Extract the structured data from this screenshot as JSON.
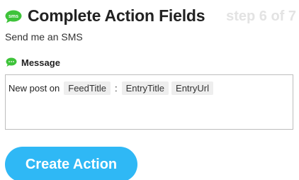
{
  "header": {
    "icon_text": "sms",
    "title": "Complete Action Fields",
    "step": "step 6 of 7"
  },
  "action_description": "Send me an SMS",
  "message_field": {
    "icon_name": "sms-chat-icon",
    "label": "Message",
    "content": {
      "prefix": "New post on",
      "ingredient_1": "FeedTitle",
      "separator": ":",
      "ingredient_2": "EntryTitle",
      "ingredient_3": "EntryUrl"
    }
  },
  "create_button": {
    "label": "Create Action"
  },
  "colors": {
    "sms_green": "#3ec33a",
    "button_blue": "#2fb8f5",
    "step_gray": "#e3e3e3",
    "ingredient_bg": "#eeeeee"
  }
}
